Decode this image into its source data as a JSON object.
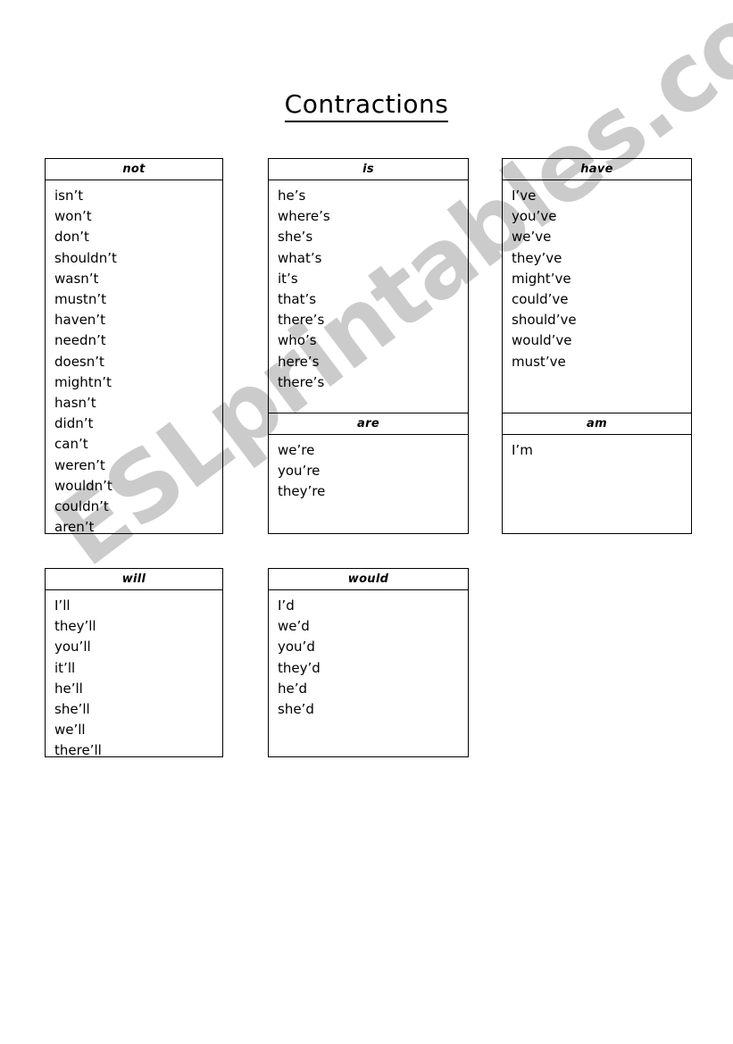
{
  "page": {
    "title": "Contractions",
    "watermark": "ESLprintables.com",
    "watermark_color": "#c9c9c9",
    "ink_color": "#000000",
    "background_color": "#ffffff"
  },
  "tables": {
    "not": {
      "header": "not",
      "items": [
        "isn’t",
        "won’t",
        "don’t",
        "shouldn’t",
        "wasn’t",
        "mustn’t",
        "haven’t",
        "needn’t",
        "doesn’t",
        "mightn’t",
        "hasn’t",
        "didn’t",
        "can’t",
        "weren’t",
        "wouldn’t",
        "couldn’t",
        "aren’t"
      ]
    },
    "is": {
      "header": "is",
      "items": [
        "he’s",
        "where’s",
        "she’s",
        "what’s",
        "it’s",
        "that’s",
        "there’s",
        "who’s",
        "here’s",
        "there’s"
      ]
    },
    "are": {
      "header": "are",
      "items": [
        "we’re",
        "you’re",
        "they’re"
      ]
    },
    "have": {
      "header": "have",
      "items": [
        "I’ve",
        "you’ve",
        "we’ve",
        "they’ve",
        "might’ve",
        "could’ve",
        "should’ve",
        "would’ve",
        "must’ve"
      ]
    },
    "am": {
      "header": "am",
      "items": [
        "I’m"
      ]
    },
    "will": {
      "header": "will",
      "items": [
        "I’ll",
        "they’ll",
        "you’ll",
        "it’ll",
        "he’ll",
        "she’ll",
        "we’ll",
        "there’ll"
      ]
    },
    "would": {
      "header": "would",
      "items": [
        "I’d",
        "we’d",
        "you’d",
        "they’d",
        "he’d",
        "she’d"
      ]
    }
  }
}
